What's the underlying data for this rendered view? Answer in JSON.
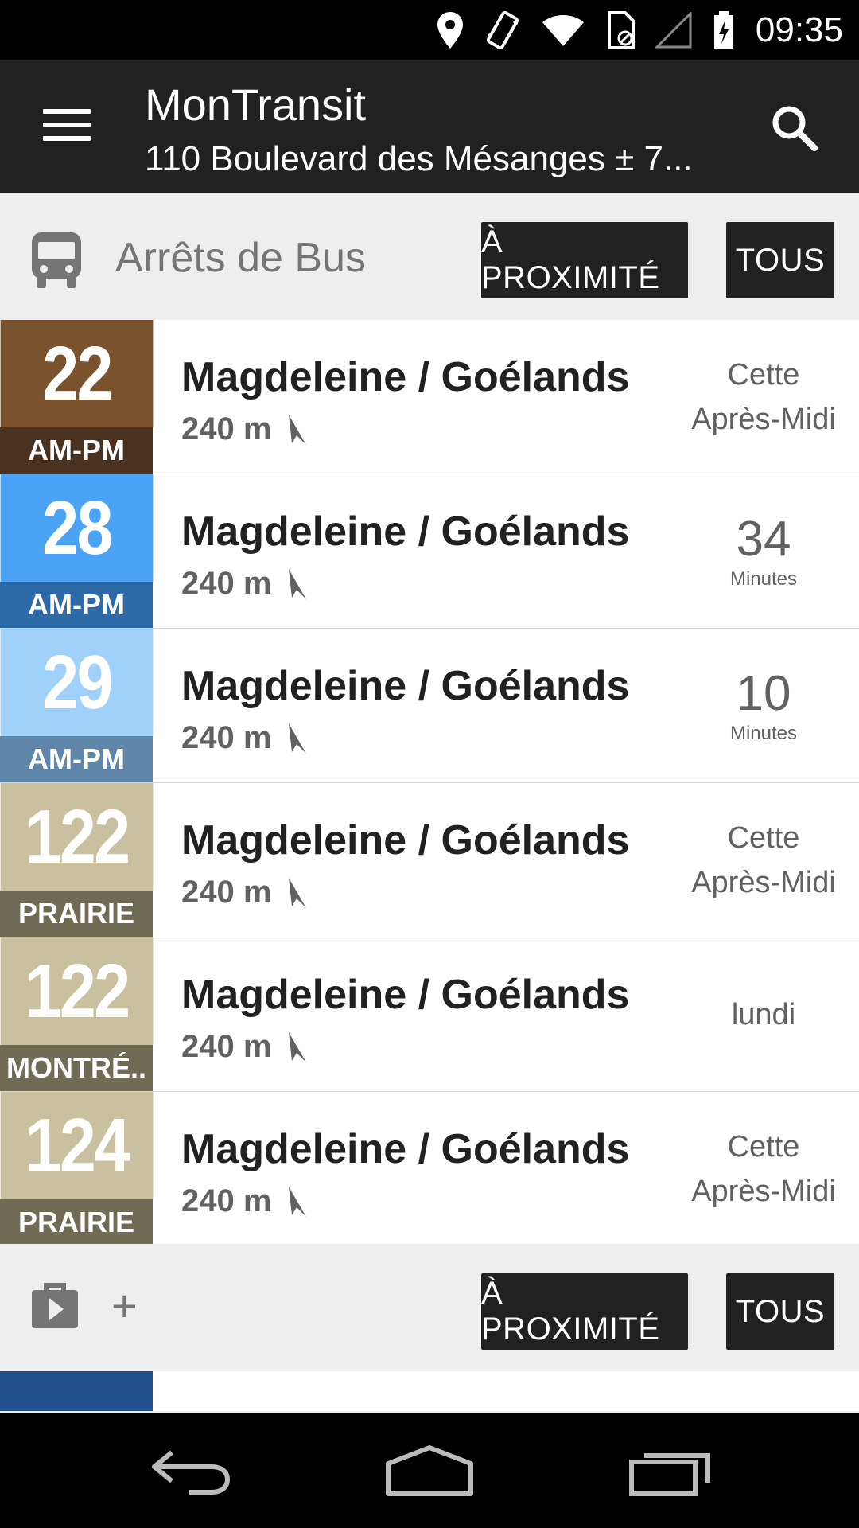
{
  "status_bar": {
    "time": "09:35"
  },
  "action_bar": {
    "title": "MonTransit",
    "subtitle": "110 Boulevard des Mésanges ± 7..."
  },
  "bus_section": {
    "title": "Arrêts de Bus",
    "nearby_label": "À PROXIMITÉ",
    "all_label": "TOUS"
  },
  "stops": [
    {
      "route": "22",
      "direction": "AM-PM",
      "name": "Magdeleine / Goélands",
      "distance": "240 m",
      "time_line1": "Cette",
      "time_line2": "Après-Midi",
      "minutes": "",
      "minutes_unit": "",
      "route_color": "#7a522e",
      "direction_color": "#4a3220"
    },
    {
      "route": "28",
      "direction": "AM-PM",
      "name": "Magdeleine / Goélands",
      "distance": "240 m",
      "time_line1": "",
      "time_line2": "",
      "minutes": "34",
      "minutes_unit": "Minutes",
      "route_color": "#4aa3f5",
      "direction_color": "#2e6aa8"
    },
    {
      "route": "29",
      "direction": "AM-PM",
      "name": "Magdeleine / Goélands",
      "distance": "240 m",
      "time_line1": "",
      "time_line2": "",
      "minutes": "10",
      "minutes_unit": "Minutes",
      "route_color": "#9fd1fb",
      "direction_color": "#5f86a8"
    },
    {
      "route": "122",
      "direction": "PRAIRIE",
      "name": "Magdeleine / Goélands",
      "distance": "240 m",
      "time_line1": "Cette",
      "time_line2": "Après-Midi",
      "minutes": "",
      "minutes_unit": "",
      "route_color": "#c8c09e",
      "direction_color": "#6f6b55"
    },
    {
      "route": "122",
      "direction": "MONTRÉ..",
      "name": "Magdeleine / Goélands",
      "distance": "240 m",
      "time_line1": "lundi",
      "time_line2": "",
      "minutes": "",
      "minutes_unit": "",
      "route_color": "#c8c09e",
      "direction_color": "#6f6b55"
    },
    {
      "route": "124",
      "direction": "PRAIRIE",
      "name": "Magdeleine / Goélands",
      "distance": "240 m",
      "time_line1": "Cette",
      "time_line2": "Après-Midi",
      "minutes": "",
      "minutes_unit": "",
      "route_color": "#c8c09e",
      "direction_color": "#6f6b55"
    }
  ],
  "second_section": {
    "icon": "play-store-bag-icon",
    "add_label": "+",
    "nearby_label": "À PROXIMITÉ",
    "all_label": "TOUS"
  },
  "colors": {
    "action_bar": "#212121",
    "button": "#212121",
    "background": "#eeeeee"
  }
}
